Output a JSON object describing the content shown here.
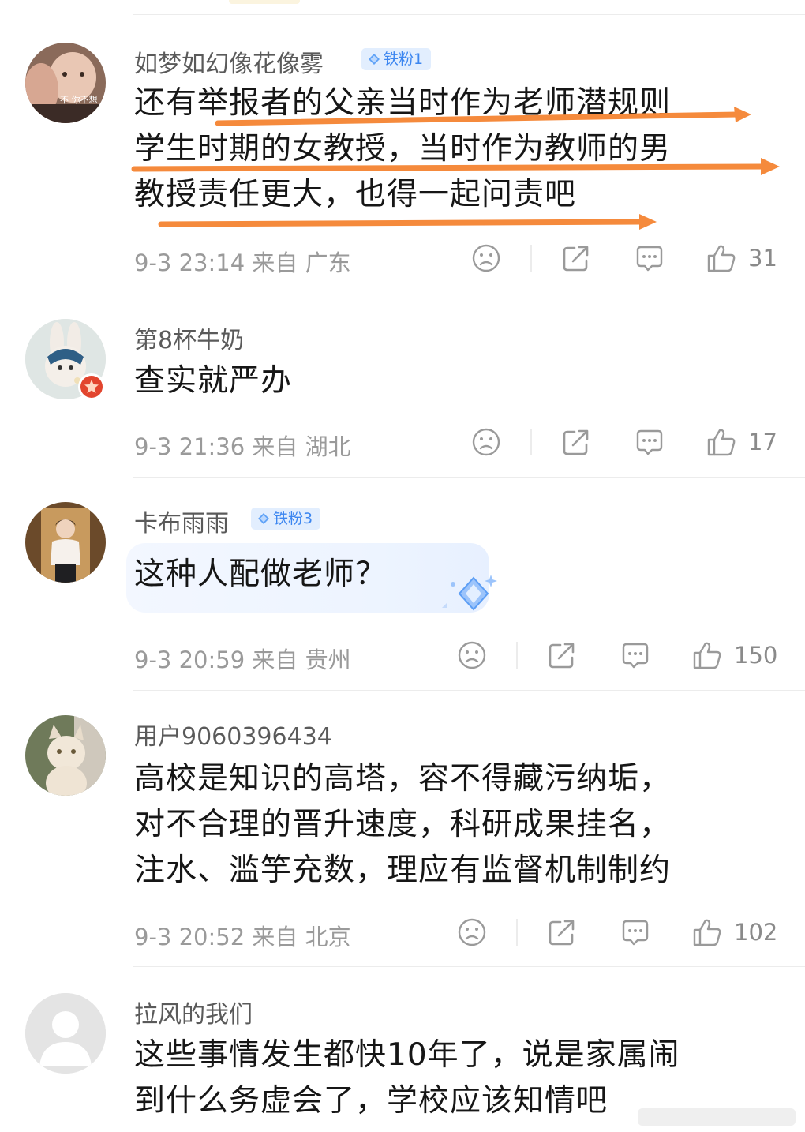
{
  "comments": [
    {
      "username": "如梦如幻像花像雾",
      "badge": "铁粉1",
      "text_lines": [
        "还有举报者的父亲当时作为老师潜规则",
        "学生时期的女教授，当时作为教师的男",
        "教授责任更大，也得一起问责吧"
      ],
      "meta": "9-3 23:14 来自 广东",
      "likes": "31",
      "avatar_text": "不 你不想"
    },
    {
      "username": "第8杯牛奶",
      "text_lines": [
        "查实就严办"
      ],
      "meta": "9-3 21:36 来自 湖北",
      "likes": "17"
    },
    {
      "username": "卡布雨雨",
      "badge": "铁粉3",
      "text_lines": [
        "这种人配做老师？"
      ],
      "meta": "9-3 20:59 来自 贵州",
      "likes": "150"
    },
    {
      "username": "用户9060396434",
      "text_lines": [
        "高校是知识的高塔，容不得藏污纳垢，",
        "对不合理的晋升速度，科研成果挂名，",
        "注水、滥竽充数，理应有监督机制制约"
      ],
      "meta": "9-3 20:52 来自 北京",
      "likes": "102"
    },
    {
      "username": "拉风的我们",
      "text_lines": [
        "这些事情发生都快10年了，说是家属闹",
        "到什么务虚会了，学校应该知情吧"
      ]
    }
  ],
  "icons": {
    "dislike": "frown-face-icon",
    "share": "share-icon",
    "comment": "comment-bubble-icon",
    "like": "thumbs-up-icon",
    "fan_badge": "diamond-gem-icon"
  },
  "colors": {
    "annotation_arrow": "#f58a3c",
    "badge_bg": "#e2eefe",
    "badge_text": "#3c86f0",
    "meta_text": "#9a9a9a",
    "username_text": "#5a5a5a"
  }
}
